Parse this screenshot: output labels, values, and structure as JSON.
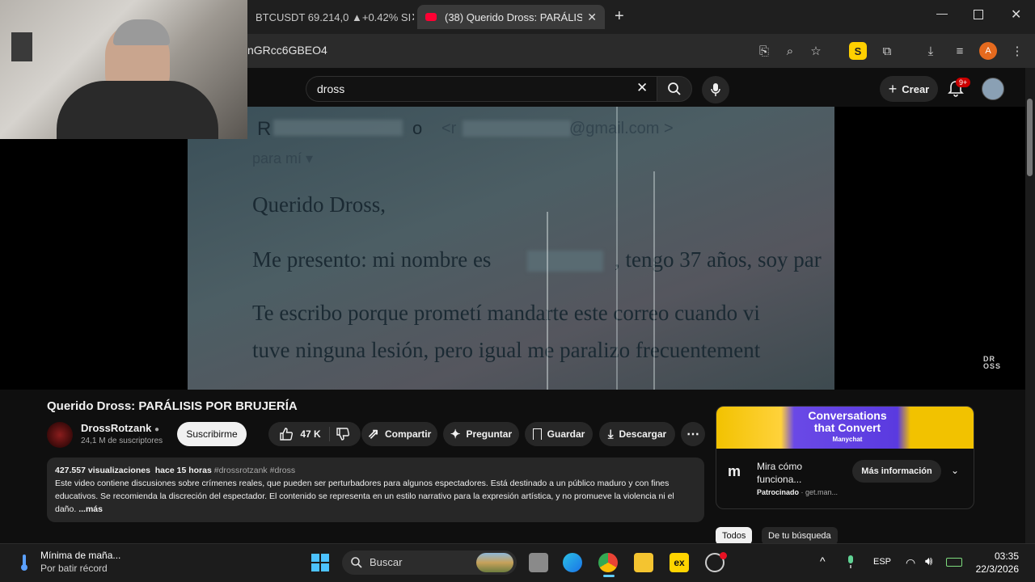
{
  "browser": {
    "tabs": [
      {
        "label": "BTCUSDT 69.214,0 ▲+0.42% SI",
        "active": false
      },
      {
        "label": "(38) Querido Dross: PARÁLISIS I",
        "active": true
      }
    ],
    "url": "nGRcc6GBEO4"
  },
  "youtube": {
    "search_query": "dross",
    "create_label": "Crear",
    "notifications_badge": "9+"
  },
  "video_frame": {
    "email_sender_initial": "R",
    "email_sender_tail": "o",
    "email_addr_start": "<r",
    "email_addr_end": "@gmail.com >",
    "email_to": "para mí ▾",
    "line1": "Querido Dross,",
    "line2a": "Me presento: mi nombre es",
    "line2b": ", tengo 37 años, soy par",
    "line3": "Te escribo porque prometí mandarte este correo cuando vi",
    "line4": "tuve ninguna lesión, pero igual me paralizo frecuentement"
  },
  "video": {
    "title": "Querido Dross: PARÁLISIS POR BRUJERÍA",
    "channel_name": "DrossRotzank",
    "subscribers": "24,1 M de suscriptores",
    "subscribe_label": "Suscribirme",
    "likes": "47 K",
    "share_label": "Compartir",
    "ask_label": "Preguntar",
    "save_label": "Guardar",
    "download_label": "Descargar"
  },
  "description": {
    "views": "427.557 visualizaciones",
    "age": "hace 15 horas",
    "tags": "#drossrotzank #dross",
    "text": "Este video contiene discusiones sobre crímenes reales, que pueden ser perturbadores para algunos espectadores. Está destinado a un público maduro y con fines educativos.  Se recomienda la discreción del espectador.  El contenido se representa en un estilo narrativo para la expresión artística, y no promueve la violencia ni el daño.",
    "more_label": "...más"
  },
  "ad": {
    "headline": "Conversations that Convert",
    "brand_small": "Manychat",
    "title": "Mira cómo funciona...",
    "sponsored": "Patrocinado",
    "domain": "get.man...",
    "cta": "Más información"
  },
  "chips": [
    {
      "label": "Todos",
      "selected": true
    },
    {
      "label": "De tu búsqueda",
      "selected": false
    }
  ],
  "taskbar": {
    "weather_title": "Mínima de maña...",
    "weather_sub": "Por batir récord",
    "search_label": "Buscar",
    "language": "ESP",
    "time": "03:35",
    "date": "22/3/2026"
  },
  "colors": {
    "youtube_bg": "#0f0f0f",
    "accent_red": "#cc0000",
    "chip_selected": "#f1f1f1"
  }
}
